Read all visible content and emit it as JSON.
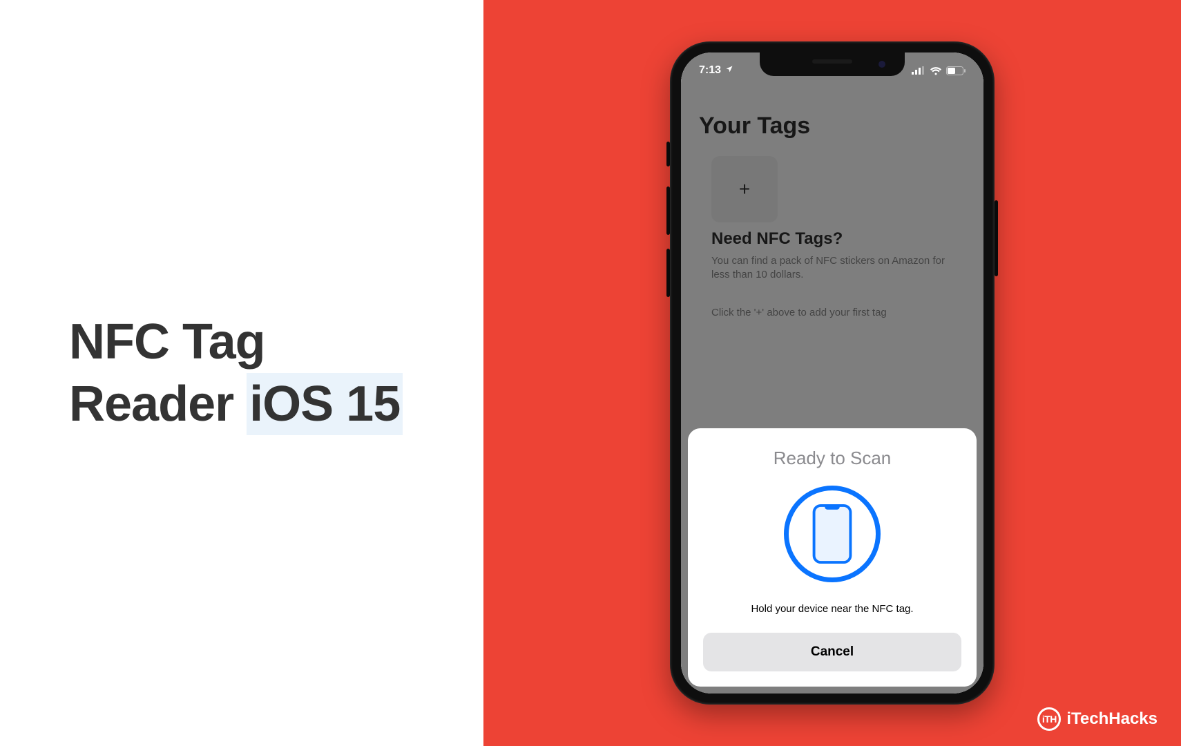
{
  "headline": {
    "line1": "NFC Tag",
    "line2_prefix": "Reader ",
    "line2_highlight": "iOS 15"
  },
  "statusbar": {
    "time": "7:13",
    "location_on": true
  },
  "app": {
    "title": "Your Tags",
    "add_glyph": "+",
    "need_title": "Need NFC Tags?",
    "need_desc": "You can find a pack of NFC stickers on Amazon for less than 10 dollars.",
    "need_hint": "Click the '+' above to add your first tag"
  },
  "sheet": {
    "title": "Ready to Scan",
    "message": "Hold your device near the NFC tag.",
    "cancel": "Cancel"
  },
  "watermark": {
    "badge": "iTH",
    "text": "iTechHacks"
  },
  "colors": {
    "accent_red": "#ed4335",
    "ios_blue": "#0a74ff",
    "text_dark": "#333333"
  }
}
